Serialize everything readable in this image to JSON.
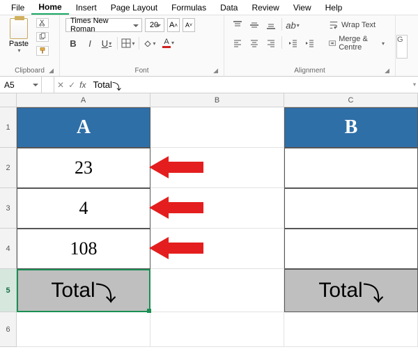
{
  "menu": {
    "items": [
      "File",
      "Home",
      "Insert",
      "Page Layout",
      "Formulas",
      "Data",
      "Review",
      "View",
      "Help"
    ],
    "active": "Home"
  },
  "ribbon": {
    "clipboard": {
      "paste": "Paste",
      "group": "Clipboard"
    },
    "font": {
      "name": "Times New Roman",
      "size": "20",
      "bold": "B",
      "italic": "I",
      "underline": "U",
      "increase": "A˄",
      "decrease": "A˅",
      "fill_letter": "A",
      "font_letter": "A",
      "group": "Font"
    },
    "alignment": {
      "wrap": "Wrap Text",
      "merge": "Merge & Centre",
      "group": "Alignment"
    },
    "extra_btn": "G"
  },
  "formula_bar": {
    "name_box": "A5",
    "cancel": "✕",
    "confirm": "✓",
    "fx": "fx",
    "content": "Total ",
    "arrow": "⤵"
  },
  "sheet": {
    "col_headers": [
      "A",
      "B",
      "C"
    ],
    "row_headers": [
      "1",
      "2",
      "3",
      "4",
      "5",
      "6"
    ],
    "A1": "A",
    "C1": "B",
    "A2": "23",
    "A3": "4",
    "A4": "108",
    "A5_text": "Total ",
    "A5_arrow": "⤵",
    "C5_text": "Total ",
    "C5_arrow": "⤵"
  }
}
